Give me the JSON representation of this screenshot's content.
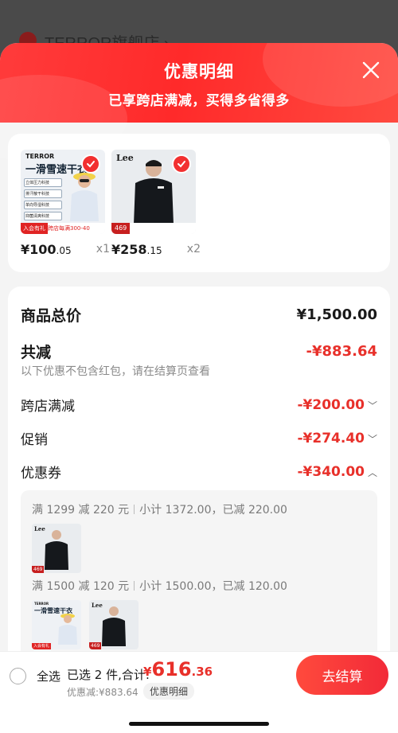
{
  "background_store": {
    "name": "TERROR旗舰店 ›"
  },
  "sheet": {
    "title": "优惠明细",
    "subtitle": "已享跨店满减，买得多省得多"
  },
  "products": [
    {
      "brand": "TERROR",
      "headline": "一滑雪速干衣",
      "features": [
        "立体压力科技",
        "排汗散干科技",
        "单向导湿科技",
        "抑菌清爽科技"
      ],
      "promo_left": "入会有礼",
      "promo_right": "跨店每满300-40",
      "price_int": "¥100",
      "price_dec": ".05",
      "qty": "x1"
    },
    {
      "brand": "Lee",
      "promo_left": "469",
      "price_int": "¥258",
      "price_dec": ".15",
      "qty": "x2"
    }
  ],
  "summary": {
    "total_label": "商品总价",
    "total_value": "¥1,500.00",
    "reduce_label": "共减",
    "reduce_value": "-¥883.64",
    "note": "以下优惠不包含红包，请在结算页查看",
    "lines": [
      {
        "label": "跨店满减",
        "value": "-¥200.00"
      },
      {
        "label": "促销",
        "value": "-¥274.40"
      },
      {
        "label": "优惠券",
        "value": "-¥340.00"
      }
    ]
  },
  "coupon_tiers": [
    {
      "rule": "满 1299 减 220 元",
      "detail": "小计 1372.00，已减 220.00"
    },
    {
      "rule": "满 1500 减 120 元",
      "detail": "小计 1500.00，已减 120.00"
    }
  ],
  "bottom_bar": {
    "select_all": "全选",
    "selected": "已选 2 件,合计:",
    "total_currency": "¥",
    "total_int": "616",
    "total_dec": ".36",
    "discount": "优惠减:¥883.64",
    "detail_btn": "优惠明细",
    "checkout": "去结算"
  },
  "colors": {
    "accent": "#f23030",
    "price_red": "#e8302a"
  }
}
